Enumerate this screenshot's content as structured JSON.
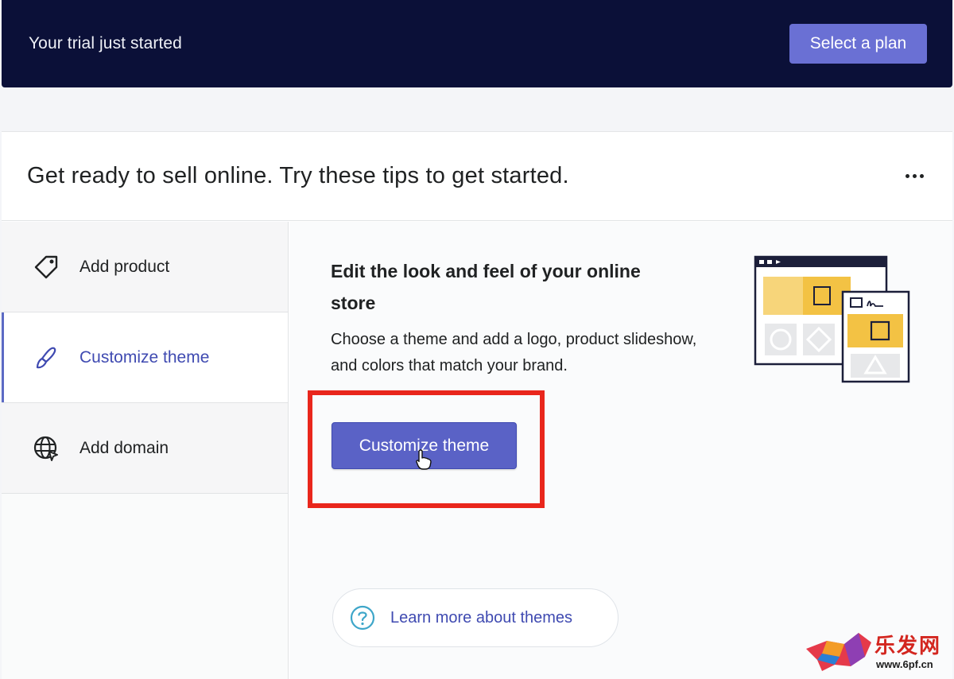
{
  "banner": {
    "text": "Your trial just started",
    "select_plan_label": "Select a plan"
  },
  "card": {
    "title": "Get ready to sell online. Try these tips to get started."
  },
  "tabs": [
    {
      "label": "Add product",
      "icon": "tag-icon",
      "active": false
    },
    {
      "label": "Customize theme",
      "icon": "brush-icon",
      "active": true
    },
    {
      "label": "Add domain",
      "icon": "globe-icon",
      "active": false
    }
  ],
  "content": {
    "title": "Edit the look and feel of your online store",
    "description": "Choose a theme and add a logo, product slideshow, and colors that match your brand.",
    "button_label": "Customize theme",
    "learn_more_label": "Learn more about themes"
  },
  "watermark": {
    "text": "乐发网",
    "url": "www.6pf.cn"
  },
  "colors": {
    "banner_bg": "#0b1038",
    "primary": "#5a62c6",
    "highlight": "#e9261c",
    "illustration_yellow": "#f3c244"
  }
}
